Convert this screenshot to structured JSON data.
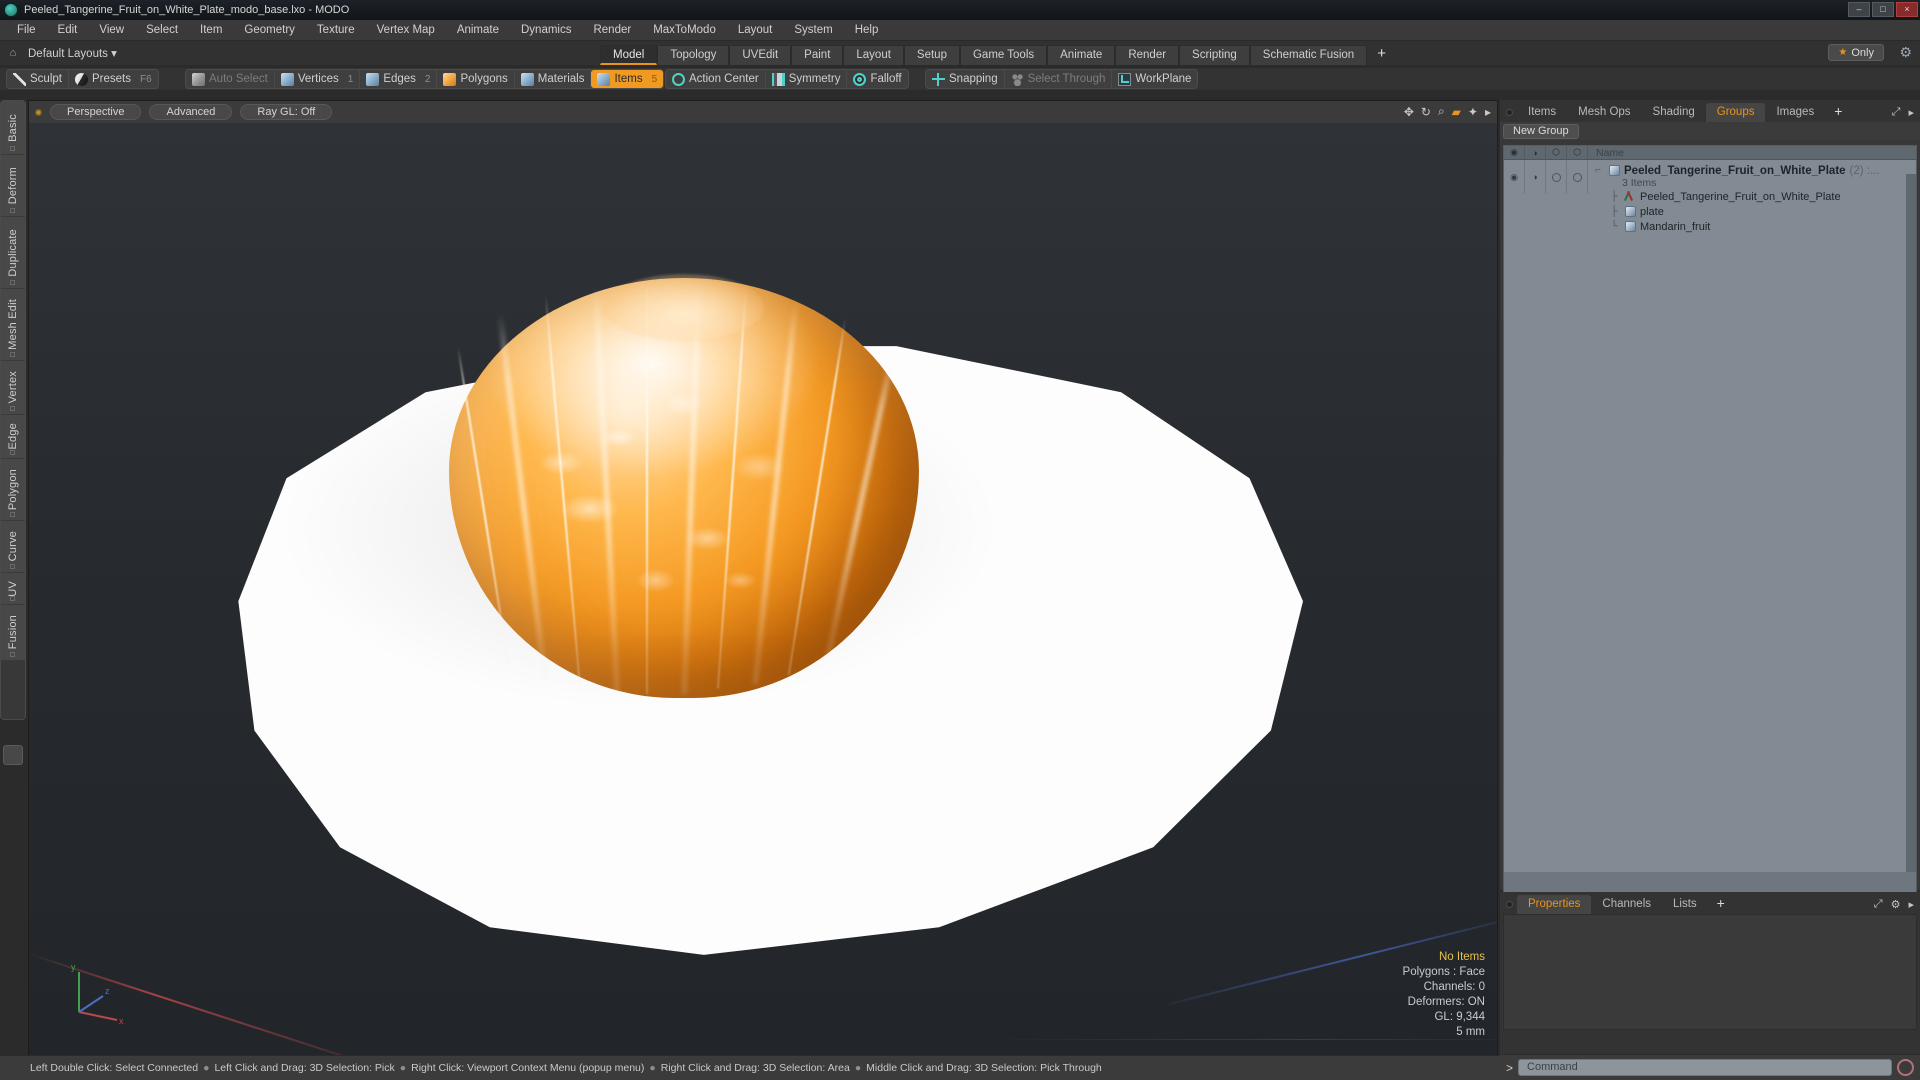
{
  "titlebar": {
    "title": "Peeled_Tangerine_Fruit_on_White_Plate_modo_base.lxo - MODO",
    "minimize": "–",
    "maximize": "□",
    "close": "×"
  },
  "menubar": {
    "items": [
      "File",
      "Edit",
      "View",
      "Select",
      "Item",
      "Geometry",
      "Texture",
      "Vertex Map",
      "Animate",
      "Dynamics",
      "Render",
      "MaxToModo",
      "Layout",
      "System",
      "Help"
    ]
  },
  "layout_row": {
    "home_icon": "home-icon",
    "default_layouts": "Default Layouts ▾",
    "tabs": [
      {
        "label": "Model",
        "active": true
      },
      {
        "label": "Topology",
        "active": false
      },
      {
        "label": "UVEdit",
        "active": false
      },
      {
        "label": "Paint",
        "active": false
      },
      {
        "label": "Layout",
        "active": false
      },
      {
        "label": "Setup",
        "active": false
      },
      {
        "label": "Game Tools",
        "active": false
      },
      {
        "label": "Animate",
        "active": false
      },
      {
        "label": "Render",
        "active": false
      },
      {
        "label": "Scripting",
        "active": false
      },
      {
        "label": "Schematic Fusion",
        "active": false
      }
    ],
    "add_tab": "+",
    "only_button": "Only",
    "only_star": "★",
    "gear": "⚙"
  },
  "toolbar": {
    "group_left": [
      {
        "label": "Sculpt",
        "icon": "pen-icon",
        "state": "normal",
        "badge": ""
      },
      {
        "label": "Presets",
        "icon": "sphere-icon",
        "state": "normal",
        "badge": "F6"
      }
    ],
    "group_select": [
      {
        "label": "Auto Select",
        "icon": "cube-grey-icon",
        "state": "dim",
        "badge": ""
      },
      {
        "label": "Vertices",
        "icon": "cube-blue-icon",
        "state": "normal",
        "badge": "1"
      },
      {
        "label": "Edges",
        "icon": "cube-blue-icon",
        "state": "normal",
        "badge": "2"
      },
      {
        "label": "Polygons",
        "icon": "cube-orange-icon",
        "state": "normal",
        "badge": ""
      },
      {
        "label": "Materials",
        "icon": "cube-blue-icon",
        "state": "normal",
        "badge": ""
      },
      {
        "label": "Items",
        "icon": "cube-blue-icon",
        "state": "active",
        "badge": "5"
      }
    ],
    "group_action": [
      {
        "label": "Action Center",
        "icon": "target-icon",
        "state": "normal",
        "badge": ""
      },
      {
        "label": "Symmetry",
        "icon": "symmetry-icon",
        "state": "normal",
        "badge": ""
      },
      {
        "label": "Falloff",
        "icon": "falloff-icon",
        "state": "normal",
        "badge": ""
      }
    ],
    "group_snap": [
      {
        "label": "Snapping",
        "icon": "snapping-icon",
        "state": "normal",
        "badge": ""
      },
      {
        "label": "Select Through",
        "icon": "select-through-icon",
        "state": "dim",
        "badge": ""
      },
      {
        "label": "WorkPlane",
        "icon": "workplane-icon",
        "state": "normal",
        "badge": ""
      }
    ]
  },
  "left_tabs": [
    "Basic",
    "Deform",
    "Duplicate",
    "Mesh Edit",
    "Vertex",
    "Edge",
    "Polygon",
    "Curve",
    "UV",
    "Fusion"
  ],
  "viewport": {
    "pills": [
      "Perspective",
      "Advanced",
      "Ray GL: Off"
    ],
    "header_icons": [
      "move-icon",
      "rotate-icon",
      "zoom-icon",
      "render-region-icon",
      "settings-icon",
      "gear-icon",
      "chevron-right-icon"
    ],
    "stats": {
      "no_items": "No Items",
      "polygons": "Polygons : Face",
      "channels": "Channels: 0",
      "deformers": "Deformers: ON",
      "gl": "GL: 9,344",
      "scale": "5 mm"
    },
    "axis_labels": {
      "y": "y",
      "x": "x",
      "z": "z"
    }
  },
  "right_panel": {
    "tabs": [
      {
        "label": "Items",
        "active": false
      },
      {
        "label": "Mesh Ops",
        "active": false
      },
      {
        "label": "Shading",
        "active": false
      },
      {
        "label": "Groups",
        "active": true
      },
      {
        "label": "Images",
        "active": false
      }
    ],
    "add_tab": "+",
    "expand_icon": "expand-icon",
    "chevron": "▸",
    "new_group_button": "New Group",
    "tree_header": {
      "col_eye": "eye-icon",
      "col_render": "render-icon",
      "col_shade1": "shade-icon",
      "col_shade2": "shade2-icon",
      "name": "Name"
    },
    "tree": {
      "root": {
        "name": "Peeled_Tangerine_Fruit_on_White_Plate",
        "count": "(2) :...",
        "sub": "3 Items"
      },
      "children": [
        {
          "name": "Peeled_Tangerine_Fruit_on_White_Plate",
          "icon": "locator-icon"
        },
        {
          "name": "plate",
          "icon": "mesh-icon"
        },
        {
          "name": "Mandarin_fruit",
          "icon": "mesh-icon"
        }
      ]
    }
  },
  "properties_panel": {
    "tabs": [
      {
        "label": "Properties",
        "active": true
      },
      {
        "label": "Channels",
        "active": false
      },
      {
        "label": "Lists",
        "active": false
      }
    ],
    "add_tab": "+",
    "expand_icon": "expand-icon",
    "gear_icon": "gear-icon",
    "chevron": "▸"
  },
  "statusbar": {
    "hints": [
      "Left Double Click: Select Connected",
      "Left Click and Drag: 3D Selection: Pick",
      "Right Click: Viewport Context Menu (popup menu)",
      "Right Click and Drag: 3D Selection: Area",
      "Middle Click and Drag: 3D Selection: Pick Through"
    ],
    "separator": "●"
  },
  "command_bar": {
    "chevron": ">",
    "placeholder": "Command",
    "value": "",
    "record_icon": "record-icon"
  },
  "colors": {
    "accent_orange": "#e8951b",
    "teal_icon": "#4fd0c8",
    "fruit_orange": "#f59a23",
    "panel_bg": "#383838",
    "tree_bg": "#828b93"
  }
}
